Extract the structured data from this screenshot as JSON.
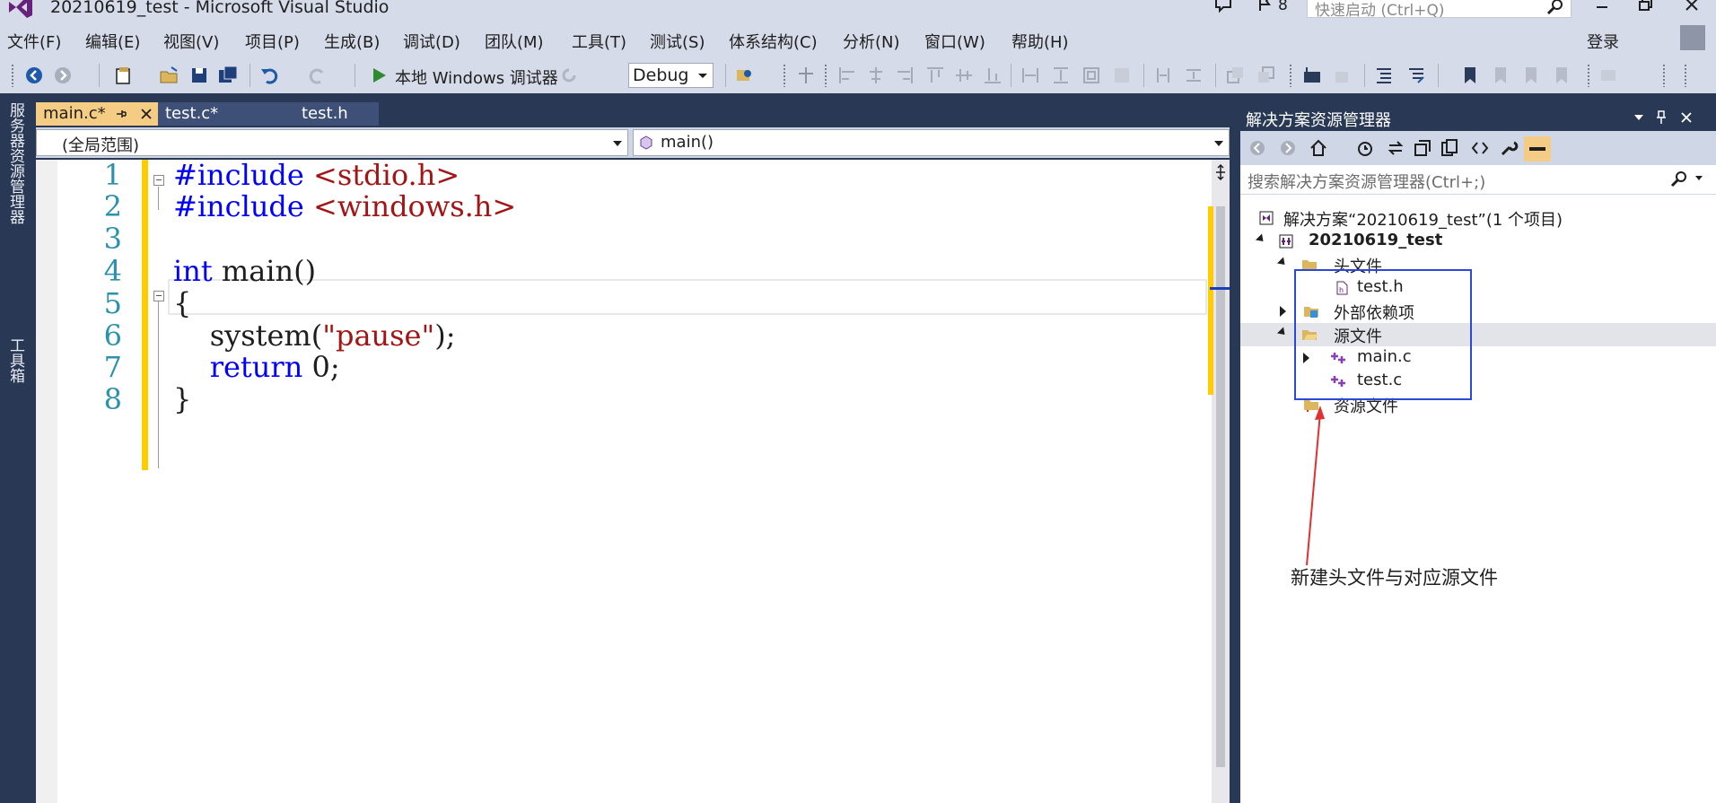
{
  "window": {
    "title": "20210619_test - Microsoft Visual Studio",
    "notification_count": "8",
    "quick_launch_placeholder": "快速启动 (Ctrl+Q)"
  },
  "menu": {
    "items": [
      "文件(F)",
      "编辑(E)",
      "视图(V)",
      "项目(P)",
      "生成(B)",
      "调试(D)",
      "团队(M)",
      "工具(T)",
      "测试(S)",
      "体系结构(C)",
      "分析(N)",
      "窗口(W)",
      "帮助(H)"
    ],
    "login": "登录"
  },
  "toolbar": {
    "run_label": "本地 Windows 调试器",
    "configuration": "Debug"
  },
  "side_strip": {
    "server_explorer": "服务器资源管理器",
    "toolbox": "工具箱"
  },
  "tabs": [
    {
      "label": "main.c*",
      "active": true
    },
    {
      "label": "test.c*",
      "active": false
    },
    {
      "label": "test.h",
      "active": false
    }
  ],
  "navbar": {
    "scope": "(全局范围)",
    "member": "main()"
  },
  "editor": {
    "line_numbers": [
      "1",
      "2",
      "3",
      "4",
      "5",
      "6",
      "7",
      "8"
    ],
    "lines": [
      {
        "tokens": [
          {
            "text": "#include ",
            "cls": "pp"
          },
          {
            "text": "<stdio.h>",
            "cls": "str"
          }
        ]
      },
      {
        "tokens": [
          {
            "text": "#include ",
            "cls": "pp"
          },
          {
            "text": "<windows.h>",
            "cls": "str"
          }
        ]
      },
      {
        "tokens": []
      },
      {
        "tokens": [
          {
            "text": "int",
            "cls": "kw"
          },
          {
            "text": " main()",
            "cls": "plain"
          }
        ]
      },
      {
        "tokens": [
          {
            "text": "{",
            "cls": "plain"
          }
        ]
      },
      {
        "tokens": [
          {
            "text": "    system(",
            "cls": "plain"
          },
          {
            "text": "\"pause\"",
            "cls": "str"
          },
          {
            "text": ");",
            "cls": "plain"
          }
        ]
      },
      {
        "tokens": [
          {
            "text": "    ",
            "cls": "plain"
          },
          {
            "text": "return",
            "cls": "kw"
          },
          {
            "text": " 0;",
            "cls": "plain"
          }
        ]
      },
      {
        "tokens": [
          {
            "text": "}",
            "cls": "plain"
          }
        ]
      }
    ]
  },
  "solution_explorer": {
    "title": "解决方案资源管理器",
    "search_placeholder": "搜索解决方案资源管理器(Ctrl+;)",
    "tree": [
      {
        "label": "解决方案“20210619_test”(1 个项目)",
        "icon": "solution-icon"
      },
      {
        "label": "20210619_test",
        "icon": "project-icon",
        "bold": true
      },
      {
        "label": "头文件",
        "icon": "folder-icon"
      },
      {
        "label": "test.h",
        "icon": "header-file-icon"
      },
      {
        "label": "外部依赖项",
        "icon": "external-deps-icon"
      },
      {
        "label": "源文件",
        "icon": "folder-open-icon"
      },
      {
        "label": "main.c",
        "icon": "c-file-icon"
      },
      {
        "label": "test.c",
        "icon": "c-file-icon"
      },
      {
        "label": "资源文件",
        "icon": "folder-icon"
      }
    ]
  },
  "annotation": {
    "text": "新建头文件与对应源文件"
  },
  "colors": {
    "accent_tab": "#f5cc84",
    "chrome": "#d6dbe9",
    "dark_frame": "#293955",
    "keyword": "#0000ff",
    "string": "#a31515",
    "line_number": "#2b91af",
    "change_bar": "#ffcc00",
    "annotation_box": "#2a49d8",
    "annotation_arrow": "#e03030"
  }
}
